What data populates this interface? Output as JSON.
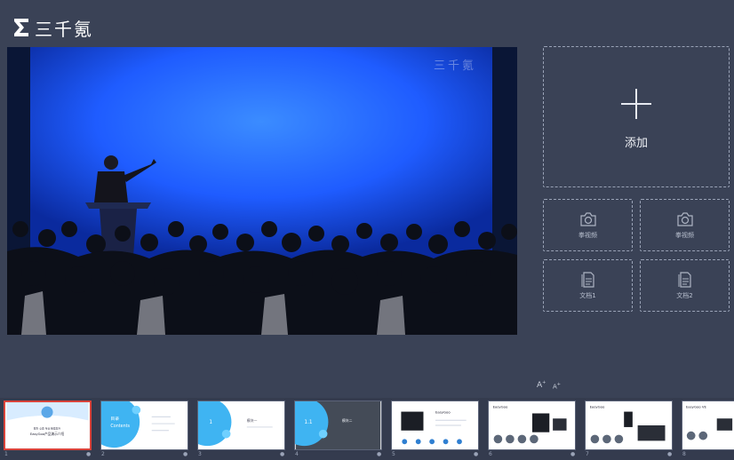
{
  "brand": {
    "name": "三千氪",
    "icon": "sigma-logo-icon"
  },
  "main_view": {
    "watermark": "三千氪",
    "icon": "presenter-stage-image"
  },
  "add_panel": {
    "label": "添加",
    "icon": "plus-icon"
  },
  "slots": [
    {
      "label": "拳视频",
      "icon": "camera-icon"
    },
    {
      "label": "拳视频",
      "icon": "camera-icon"
    },
    {
      "label": "文档1",
      "icon": "document-icon"
    },
    {
      "label": "文档2",
      "icon": "document-icon"
    }
  ],
  "font_controls": {
    "increase": "A",
    "increase_sup": "+",
    "decrease": "A",
    "decrease_sup": "+"
  },
  "slides": [
    {
      "num": "1",
      "title": "EasyGoo产品演示介绍",
      "subtitle": "服务 全面 专业 精准提升"
    },
    {
      "num": "2",
      "title": "目录",
      "subtitle": "Contents"
    },
    {
      "num": "3",
      "title": "模块一",
      "subtitle": "1"
    },
    {
      "num": "4",
      "title": "模块二",
      "subtitle": "1.1"
    },
    {
      "num": "5",
      "title": "EasyGoo",
      "subtitle": ""
    },
    {
      "num": "6",
      "title": "EasyGoo",
      "subtitle": ""
    },
    {
      "num": "7",
      "title": "EasyGoo",
      "subtitle": ""
    },
    {
      "num": "8",
      "title": "EasyGoo VE",
      "subtitle": ""
    }
  ],
  "colors": {
    "background": "#3a4256",
    "active_border": "#d9433b",
    "stage_blue": "#1f5cff"
  }
}
